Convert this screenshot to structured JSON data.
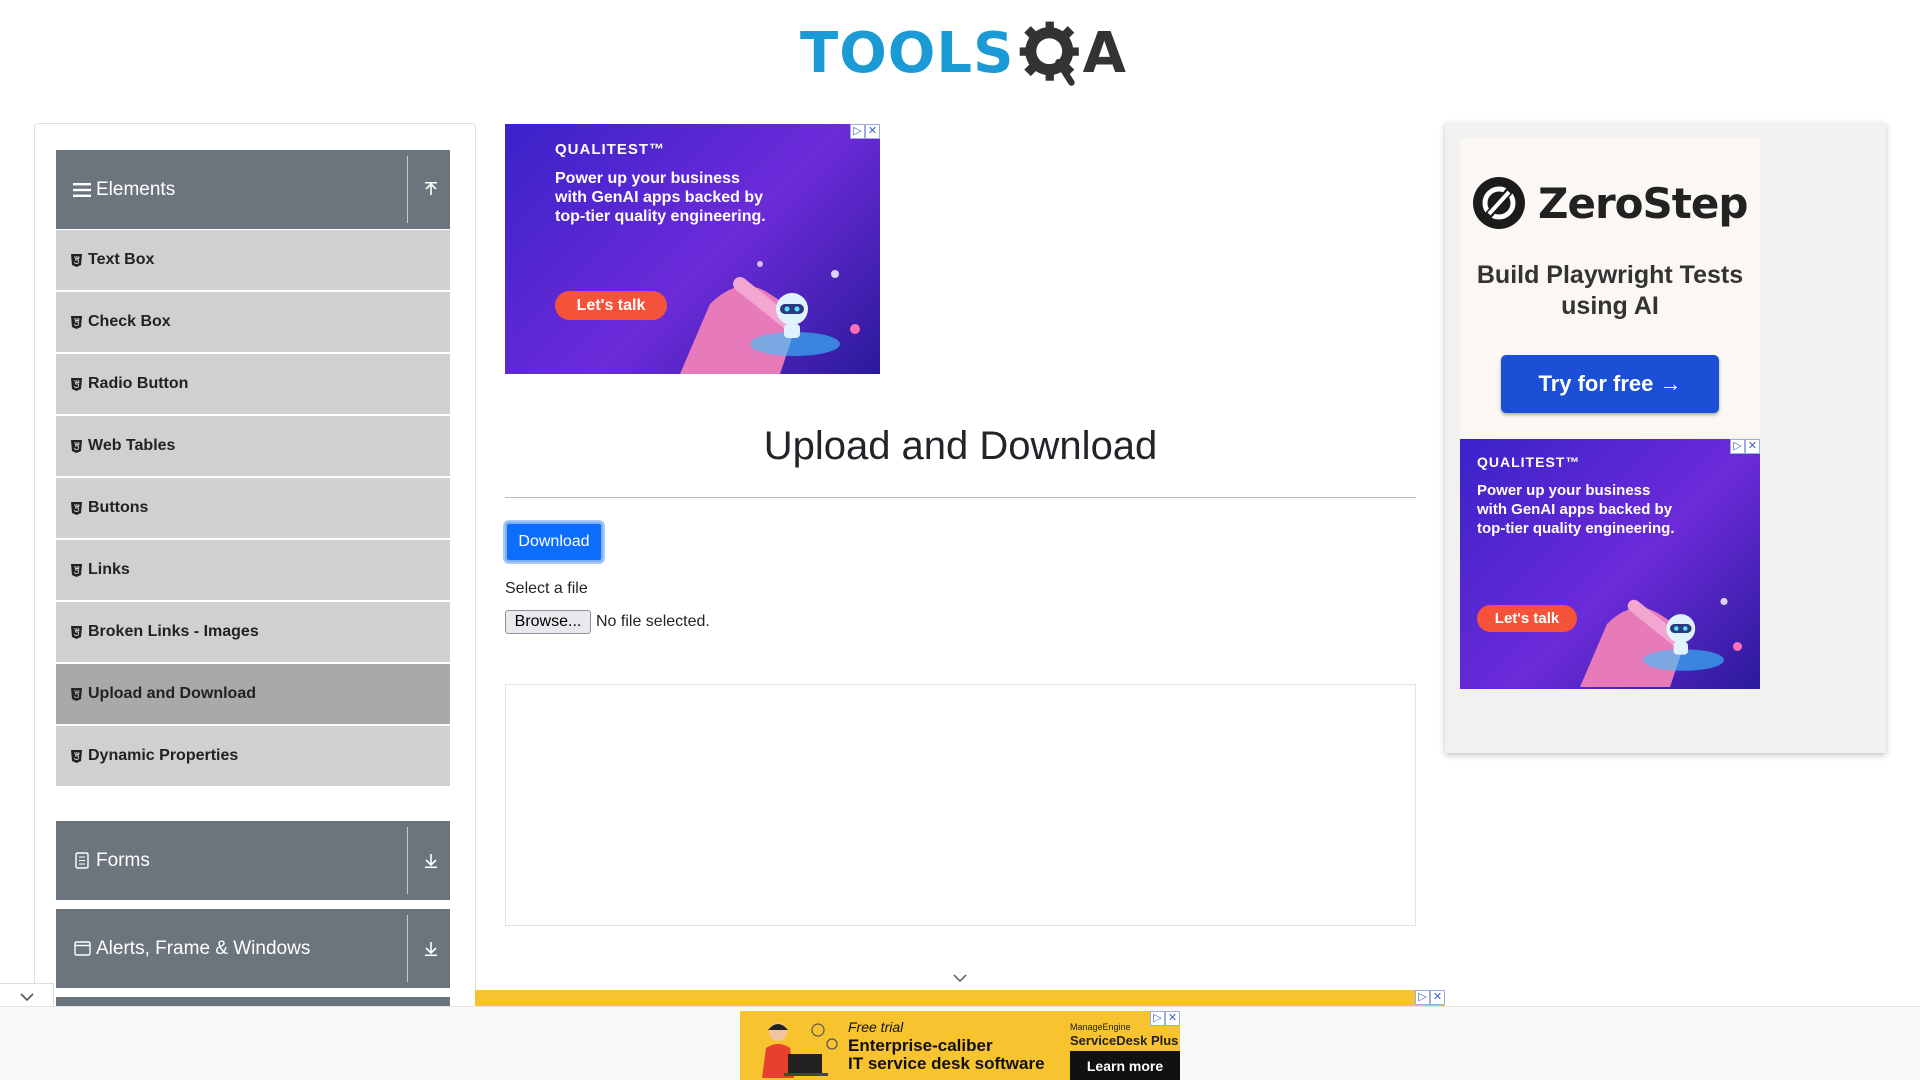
{
  "header": {
    "logo_text_1": "TOOLS",
    "logo_text_2": "A"
  },
  "sidebar": {
    "groups": [
      {
        "label": "Elements",
        "icon": "menu-icon",
        "state": "expanded"
      },
      {
        "label": "Forms",
        "icon": "form-icon",
        "state": "collapsed"
      },
      {
        "label": "Alerts, Frame & Windows",
        "icon": "window-icon",
        "state": "collapsed"
      }
    ],
    "items": [
      {
        "label": "Text Box"
      },
      {
        "label": "Check Box"
      },
      {
        "label": "Radio Button"
      },
      {
        "label": "Web Tables"
      },
      {
        "label": "Buttons"
      },
      {
        "label": "Links"
      },
      {
        "label": "Broken Links - Images"
      },
      {
        "label": "Upload and Download",
        "active": true
      },
      {
        "label": "Dynamic Properties"
      }
    ]
  },
  "main": {
    "title": "Upload and Download",
    "download_label": "Download",
    "select_label": "Select a file",
    "browse_label": "Browse...",
    "file_status": "No file selected."
  },
  "ads": {
    "qualitest": {
      "brand": "QUALITEST™",
      "text": "Power up your business with GenAI apps backed by top-tier quality engineering.",
      "cta": "Let's talk"
    },
    "zerostep": {
      "logo_text": "ZeroStep",
      "tagline": "Build Playwright Tests using AI",
      "cta": "Try for free →"
    },
    "bottom": {
      "small": "Free trial",
      "line1": "Enterprise-caliber",
      "line2": "IT service desk software",
      "brand_top": "ManageEngine",
      "brand": "ServiceDesk Plus",
      "cta": "Learn more"
    }
  },
  "colors": {
    "sidebar_header": "#6c757d",
    "sidebar_item": "#d0d0d0",
    "sidebar_item_active": "#a9a9a9",
    "primary": "#0d6efd",
    "logo_blue": "#1b9bd6",
    "ad_orange": "#f5523a",
    "ad_yellow": "#f7c32e"
  }
}
